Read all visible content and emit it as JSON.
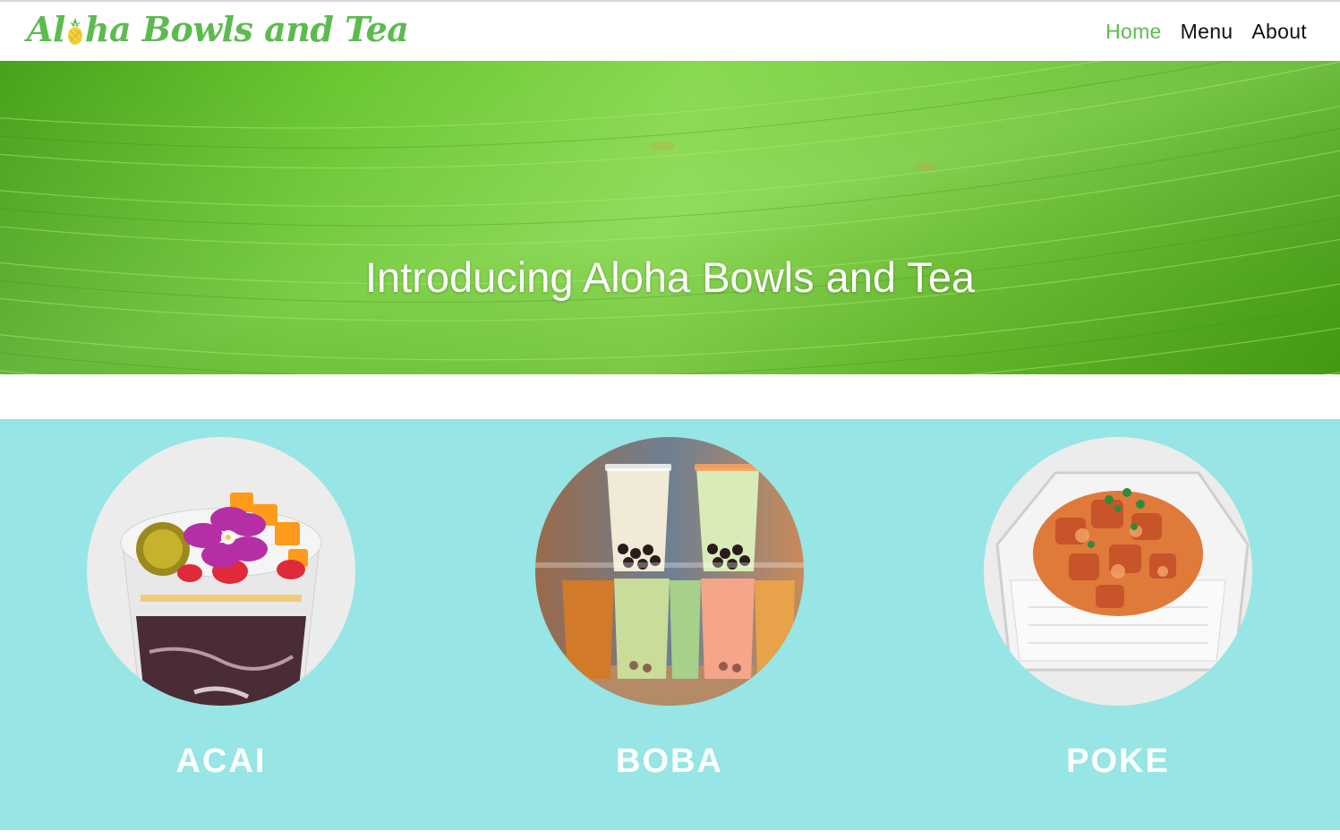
{
  "header": {
    "logo_text_before": "Al",
    "logo_text_after": "ha Bowls and Tea",
    "nav": [
      {
        "label": "Home",
        "active": true
      },
      {
        "label": "Menu",
        "active": false
      },
      {
        "label": "About",
        "active": false
      }
    ]
  },
  "hero": {
    "title": "Introducing Aloha Bowls and Tea"
  },
  "products": [
    {
      "label": "ACAI",
      "icon": "acai-bowl-photo"
    },
    {
      "label": "BOBA",
      "icon": "boba-tea-photo"
    },
    {
      "label": "POKE",
      "icon": "poke-bowl-photo"
    }
  ],
  "colors": {
    "brand_green": "#5cbb4e",
    "products_background": "#97e5e5",
    "nav_text": "#111111"
  }
}
